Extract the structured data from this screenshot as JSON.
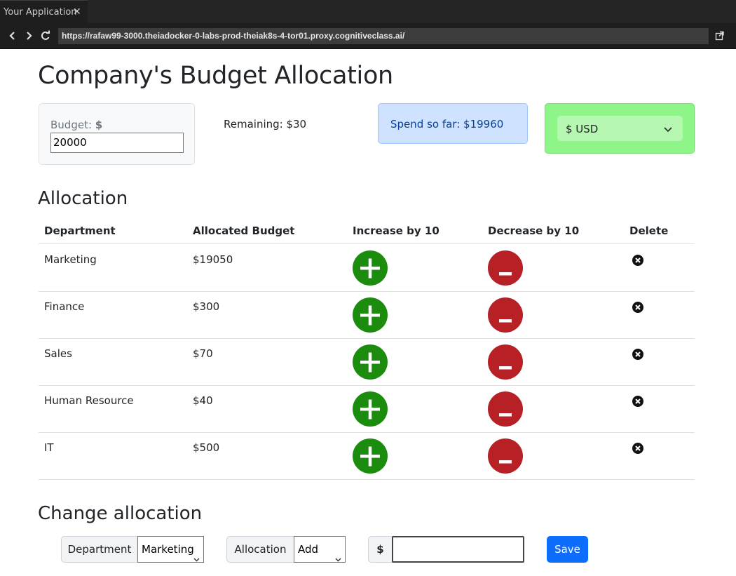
{
  "browser": {
    "tab_title": "Your Application",
    "tab_close": "✕",
    "url": "https://rafaw99-3000.theiadocker-0-labs-prod-theiak8s-4-tor01.proxy.cognitiveclass.ai/"
  },
  "page": {
    "title": "Company's Budget Allocation",
    "budget": {
      "label": "Budget: ",
      "symbol": "$",
      "value": "20000"
    },
    "remaining": "Remaining: $30",
    "spend_so_far": "Spend so far: $19960",
    "currency": {
      "selected": "$ USD"
    }
  },
  "allocation": {
    "heading": "Allocation",
    "columns": [
      "Department",
      "Allocated Budget",
      "Increase by 10",
      "Decrease by 10",
      "Delete"
    ],
    "rows": [
      {
        "department": "Marketing",
        "budget": "$19050"
      },
      {
        "department": "Finance",
        "budget": "$300"
      },
      {
        "department": "Sales",
        "budget": "$70"
      },
      {
        "department": "Human Resource",
        "budget": "$40"
      },
      {
        "department": "IT",
        "budget": "$500"
      }
    ]
  },
  "change": {
    "heading": "Change allocation",
    "department_label": "Department",
    "department_selected": "Marketing",
    "allocation_label": "Allocation",
    "allocation_selected": "Add",
    "currency_prefix": "$",
    "amount_value": "",
    "save_label": "Save"
  },
  "colors": {
    "increase": "#1c8c0f",
    "decrease": "#b72025",
    "spend_bg": "#cfe2ff",
    "currency_bg": "#8ef588",
    "save_bg": "#0d6efd"
  }
}
